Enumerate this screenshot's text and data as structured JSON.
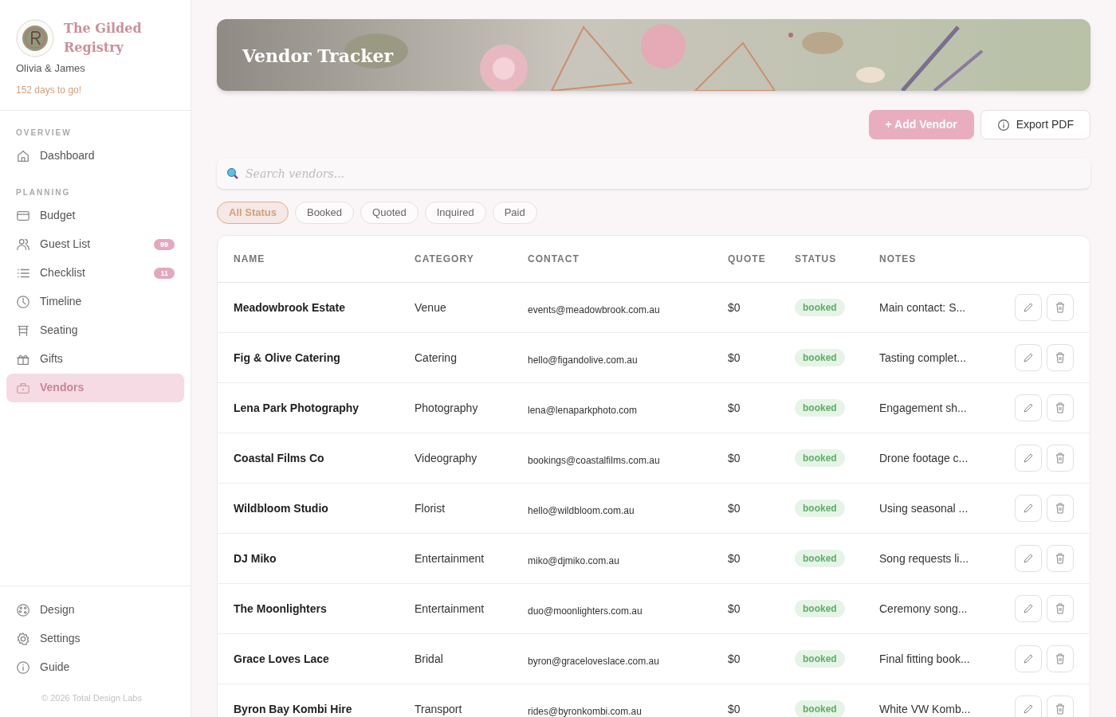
{
  "brand": {
    "title": "The Gilded Registry",
    "couple": "Olivia & James",
    "countdown": "152 days to go!"
  },
  "sidebar": {
    "sections": [
      {
        "heading": "OVERVIEW",
        "items": [
          {
            "label": "Dashboard",
            "selected": false
          }
        ]
      },
      {
        "heading": "PLANNING",
        "items": [
          {
            "label": "Budget",
            "selected": false
          },
          {
            "label": "Guest List",
            "badge": "99",
            "selected": false
          },
          {
            "label": "Checklist",
            "badge": "11",
            "selected": false
          },
          {
            "label": "Timeline",
            "selected": false
          },
          {
            "label": "Seating",
            "selected": false
          },
          {
            "label": "Gifts",
            "selected": false
          },
          {
            "label": "Vendors",
            "selected": true
          }
        ]
      }
    ],
    "footer_items": [
      {
        "label": "Design"
      },
      {
        "label": "Settings"
      },
      {
        "label": "Guide"
      }
    ],
    "copyright": "© 2026 Total Design Labs"
  },
  "page": {
    "title": "Vendor Tracker",
    "buttons": [
      {
        "label": "+ Add Vendor",
        "kind": "primary"
      },
      {
        "label": "Export PDF",
        "kind": "secondary"
      }
    ],
    "search": {
      "placeholder": "Search vendors..."
    },
    "filters": [
      {
        "label": "All Status",
        "selected": true
      },
      {
        "label": "Booked",
        "selected": false
      },
      {
        "label": "Quoted",
        "selected": false
      },
      {
        "label": "Inquired",
        "selected": false
      },
      {
        "label": "Paid",
        "selected": false
      }
    ]
  },
  "table": {
    "columns": [
      "NAME",
      "CATEGORY",
      "CONTACT",
      "QUOTE",
      "STATUS",
      "NOTES"
    ],
    "rows": [
      {
        "name": "Meadowbrook Estate",
        "category": "Venue",
        "contact": "events@meadowbrook.com.au",
        "quote": "$0",
        "status": "booked",
        "notes": "Main contact: S..."
      },
      {
        "name": "Fig & Olive Catering",
        "category": "Catering",
        "contact": "hello@figandolive.com.au",
        "quote": "$0",
        "status": "booked",
        "notes": "Tasting complet..."
      },
      {
        "name": "Lena Park Photography",
        "category": "Photography",
        "contact": "lena@lenaparkphoto.com",
        "quote": "$0",
        "status": "booked",
        "notes": "Engagement sh..."
      },
      {
        "name": "Coastal Films Co",
        "category": "Videography",
        "contact": "bookings@coastalfilms.com.au",
        "quote": "$0",
        "status": "booked",
        "notes": "Drone footage c..."
      },
      {
        "name": "Wildbloom Studio",
        "category": "Florist",
        "contact": "hello@wildbloom.com.au",
        "quote": "$0",
        "status": "booked",
        "notes": "Using seasonal ..."
      },
      {
        "name": "DJ Miko",
        "category": "Entertainment",
        "contact": "miko@djmiko.com.au",
        "quote": "$0",
        "status": "booked",
        "notes": "Song requests li..."
      },
      {
        "name": "The Moonlighters",
        "category": "Entertainment",
        "contact": "duo@moonlighters.com.au",
        "quote": "$0",
        "status": "booked",
        "notes": "Ceremony song..."
      },
      {
        "name": "Grace Loves Lace",
        "category": "Bridal",
        "contact": "byron@graceloveslace.com.au",
        "quote": "$0",
        "status": "booked",
        "notes": "Final fitting book..."
      },
      {
        "name": "Byron Bay Kombi Hire",
        "category": "Transport",
        "contact": "rides@byronkombi.com.au",
        "quote": "$0",
        "status": "booked",
        "notes": "White VW Komb..."
      }
    ]
  }
}
